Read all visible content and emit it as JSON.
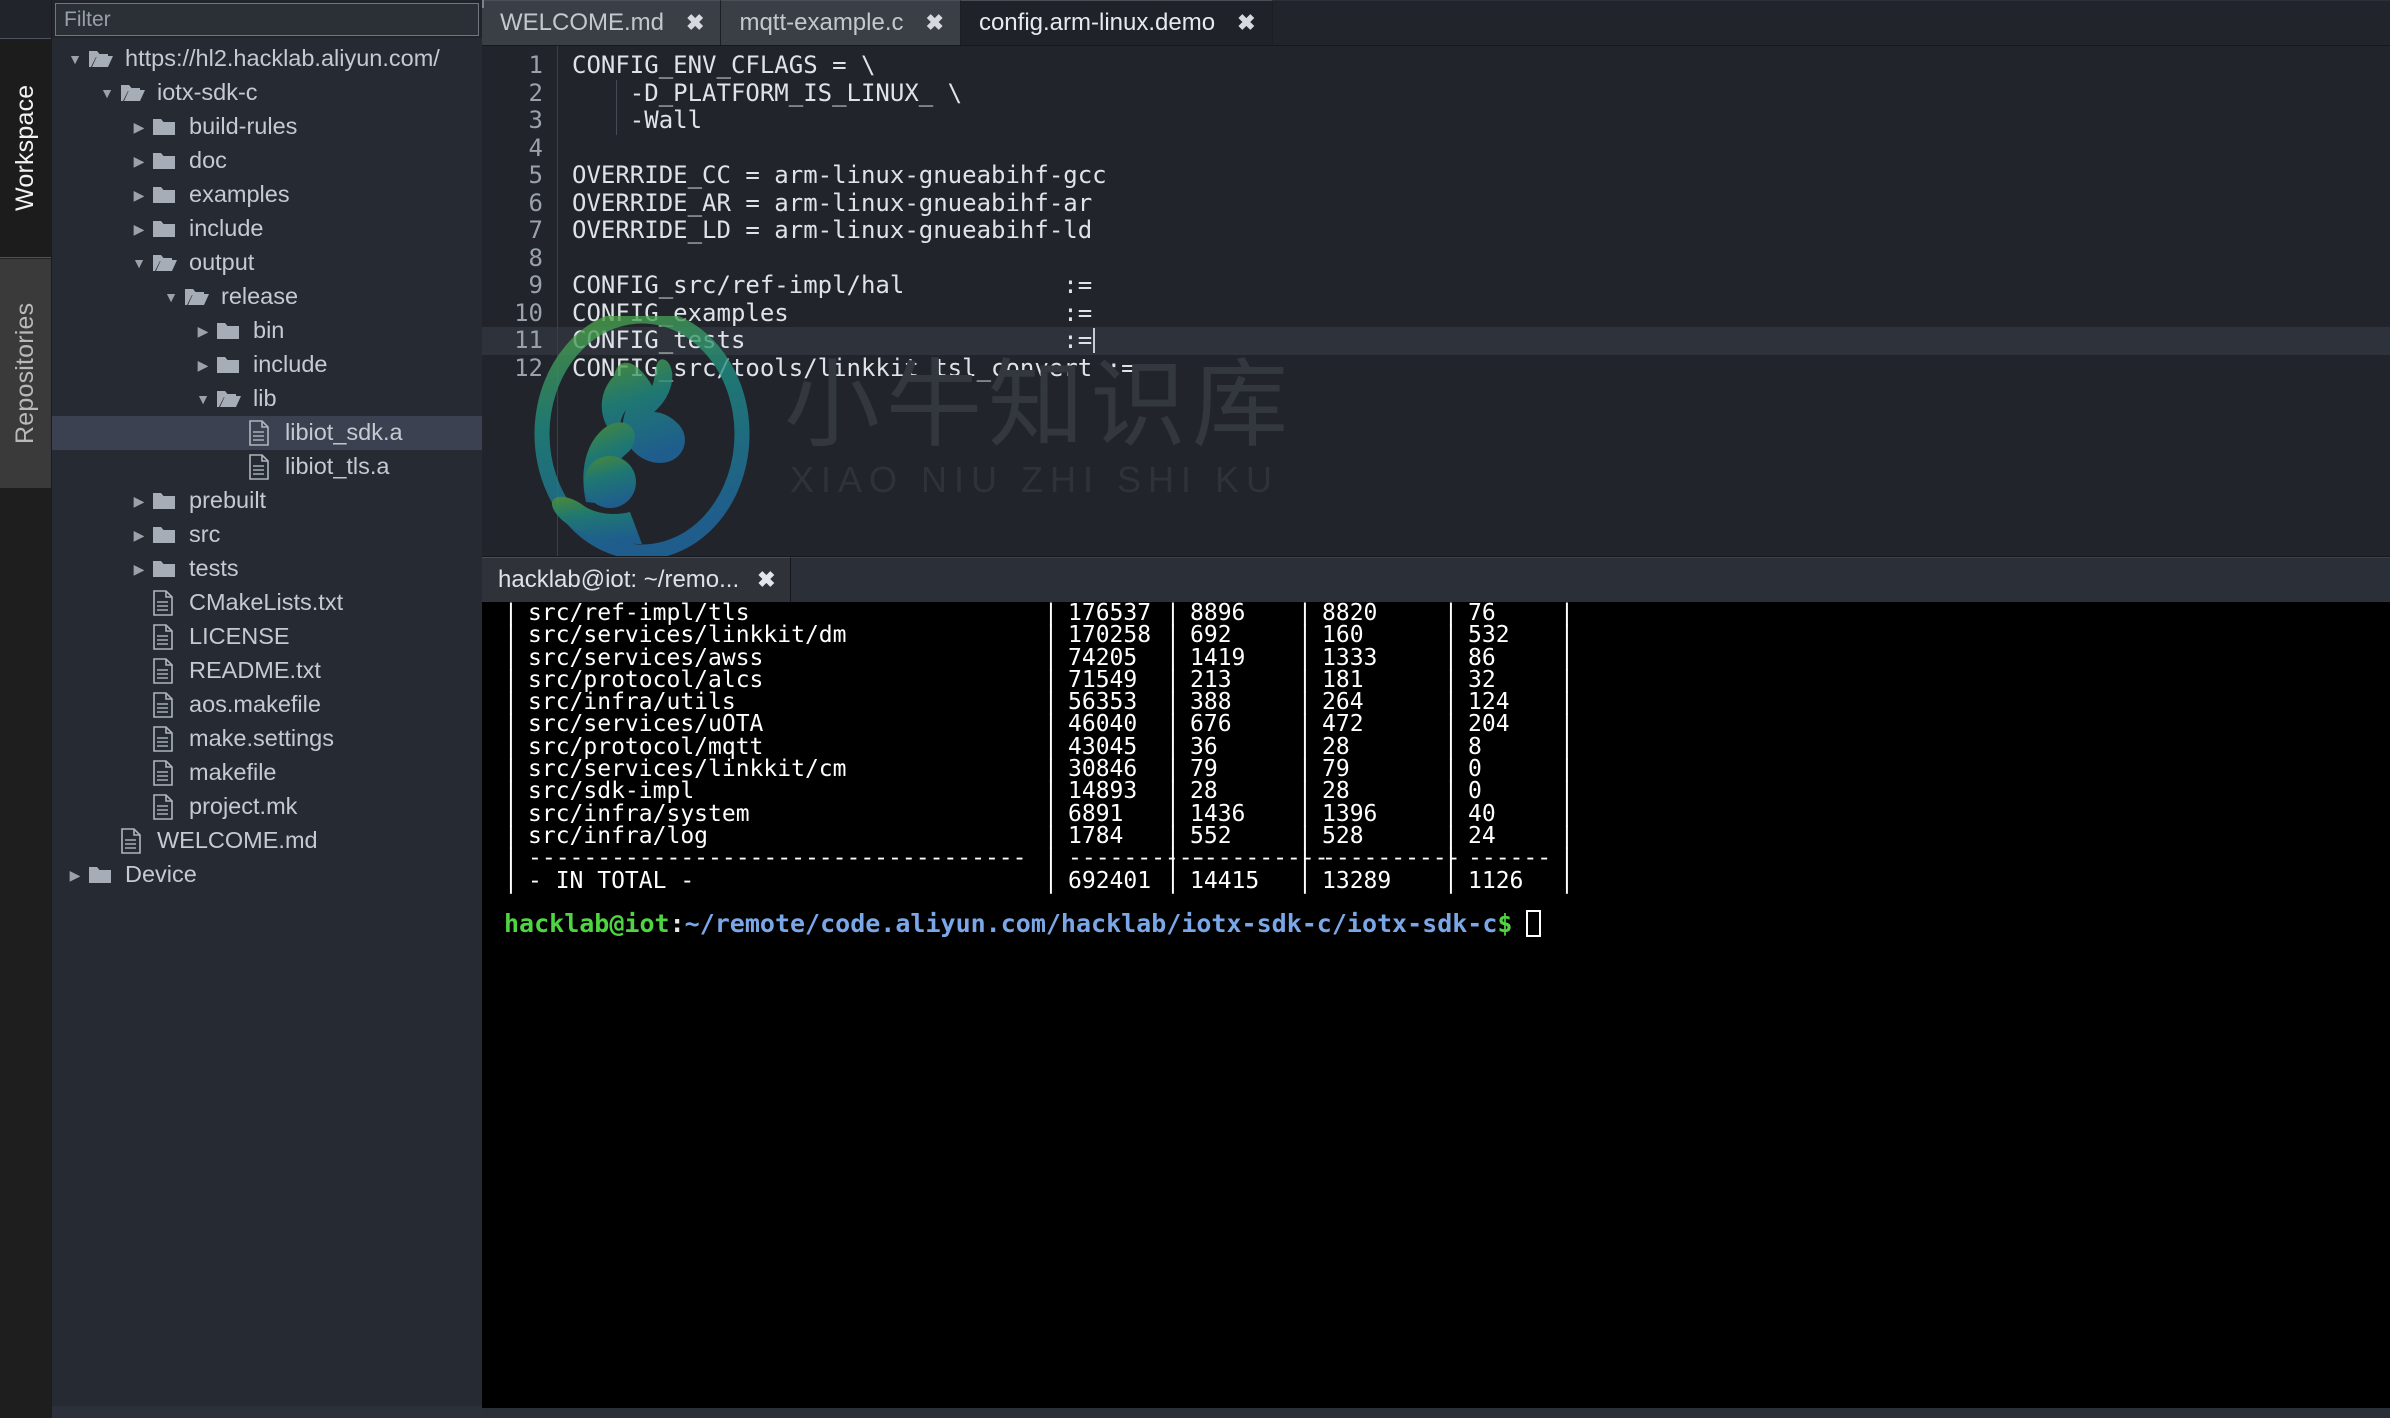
{
  "rail": {
    "tabs": [
      {
        "label": "Workspace",
        "active": true
      },
      {
        "label": "Repositories",
        "active": false
      }
    ]
  },
  "sidebar": {
    "filter": {
      "placeholder": "Filter",
      "value": ""
    },
    "tree": [
      {
        "label": "https://hl2.hacklab.aliyun.com/",
        "icon": "folder-open-icon",
        "twisty": "▼",
        "depth": 0,
        "selected": false
      },
      {
        "label": "iotx-sdk-c",
        "icon": "folder-open-icon",
        "twisty": "▼",
        "depth": 1,
        "selected": false
      },
      {
        "label": "build-rules",
        "icon": "folder-closed-icon",
        "twisty": "▶",
        "depth": 2,
        "selected": false
      },
      {
        "label": "doc",
        "icon": "folder-closed-icon",
        "twisty": "▶",
        "depth": 2,
        "selected": false
      },
      {
        "label": "examples",
        "icon": "folder-closed-icon",
        "twisty": "▶",
        "depth": 2,
        "selected": false
      },
      {
        "label": "include",
        "icon": "folder-closed-icon",
        "twisty": "▶",
        "depth": 2,
        "selected": false
      },
      {
        "label": "output",
        "icon": "folder-open-icon",
        "twisty": "▼",
        "depth": 2,
        "selected": false
      },
      {
        "label": "release",
        "icon": "folder-open-icon",
        "twisty": "▼",
        "depth": 3,
        "selected": false
      },
      {
        "label": "bin",
        "icon": "folder-closed-icon",
        "twisty": "▶",
        "depth": 4,
        "selected": false
      },
      {
        "label": "include",
        "icon": "folder-closed-icon",
        "twisty": "▶",
        "depth": 4,
        "selected": false
      },
      {
        "label": "lib",
        "icon": "folder-open-icon",
        "twisty": "▼",
        "depth": 4,
        "selected": false
      },
      {
        "label": "libiot_sdk.a",
        "icon": "file-icon",
        "twisty": "",
        "depth": 5,
        "selected": true
      },
      {
        "label": "libiot_tls.a",
        "icon": "file-icon",
        "twisty": "",
        "depth": 5,
        "selected": false
      },
      {
        "label": "prebuilt",
        "icon": "folder-closed-icon",
        "twisty": "▶",
        "depth": 2,
        "selected": false
      },
      {
        "label": "src",
        "icon": "folder-closed-icon",
        "twisty": "▶",
        "depth": 2,
        "selected": false
      },
      {
        "label": "tests",
        "icon": "folder-closed-icon",
        "twisty": "▶",
        "depth": 2,
        "selected": false
      },
      {
        "label": "CMakeLists.txt",
        "icon": "file-icon",
        "twisty": "",
        "depth": 2,
        "selected": false
      },
      {
        "label": "LICENSE",
        "icon": "file-icon",
        "twisty": "",
        "depth": 2,
        "selected": false
      },
      {
        "label": "README.txt",
        "icon": "file-icon",
        "twisty": "",
        "depth": 2,
        "selected": false
      },
      {
        "label": "aos.makefile",
        "icon": "file-icon",
        "twisty": "",
        "depth": 2,
        "selected": false
      },
      {
        "label": "make.settings",
        "icon": "file-icon",
        "twisty": "",
        "depth": 2,
        "selected": false
      },
      {
        "label": "makefile",
        "icon": "file-icon",
        "twisty": "",
        "depth": 2,
        "selected": false
      },
      {
        "label": "project.mk",
        "icon": "file-icon",
        "twisty": "",
        "depth": 2,
        "selected": false
      },
      {
        "label": "WELCOME.md",
        "icon": "file-icon",
        "twisty": "",
        "depth": 1,
        "selected": false
      },
      {
        "label": "Device",
        "icon": "folder-closed-icon",
        "twisty": "▶",
        "depth": 0,
        "selected": false
      }
    ]
  },
  "editor": {
    "tabs": [
      {
        "label": "WELCOME.md",
        "active": false,
        "close": "✖"
      },
      {
        "label": "mqtt-example.c",
        "active": false,
        "close": "✖"
      },
      {
        "label": "config.arm-linux.demo",
        "active": true,
        "close": "✖"
      }
    ],
    "current_line": 11,
    "lines": [
      {
        "n": "1",
        "text": "CONFIG_ENV_CFLAGS = \\"
      },
      {
        "n": "2",
        "text": "    -D_PLATFORM_IS_LINUX_ \\"
      },
      {
        "n": "3",
        "text": "    -Wall"
      },
      {
        "n": "4",
        "text": ""
      },
      {
        "n": "5",
        "text": "OVERRIDE_CC = arm-linux-gnueabihf-gcc"
      },
      {
        "n": "6",
        "text": "OVERRIDE_AR = arm-linux-gnueabihf-ar"
      },
      {
        "n": "7",
        "text": "OVERRIDE_LD = arm-linux-gnueabihf-ld"
      },
      {
        "n": "8",
        "text": ""
      },
      {
        "n": "9",
        "text": "CONFIG_src/ref-impl/hal           :="
      },
      {
        "n": "10",
        "text": "CONFIG_examples                   :="
      },
      {
        "n": "11",
        "text": "CONFIG_tests                      :="
      },
      {
        "n": "12",
        "text": "CONFIG_src/tools/linkkit_tsl_convert :="
      }
    ]
  },
  "watermark": {
    "cn_text": "小牛知识库",
    "pinyin_text": "XIAO NIU ZHI SHI KU",
    "color_top": "#4f9a3a",
    "color_bottom": "#1f6fa8"
  },
  "terminal": {
    "tab": {
      "label": "hacklab@iot: ~/remo...",
      "close": "✖"
    },
    "table": {
      "rows": [
        {
          "path": "src/ref-impl/tls",
          "c1": "176537",
          "c2": "8896",
          "c3": "8820",
          "c4": "76"
        },
        {
          "path": "src/services/linkkit/dm",
          "c1": "170258",
          "c2": "692",
          "c3": "160",
          "c4": "532"
        },
        {
          "path": "src/services/awss",
          "c1": "74205",
          "c2": "1419",
          "c3": "1333",
          "c4": "86"
        },
        {
          "path": "src/protocol/alcs",
          "c1": "71549",
          "c2": "213",
          "c3": "181",
          "c4": "32"
        },
        {
          "path": "src/infra/utils",
          "c1": "56353",
          "c2": "388",
          "c3": "264",
          "c4": "124"
        },
        {
          "path": "src/services/uOTA",
          "c1": "46040",
          "c2": "676",
          "c3": "472",
          "c4": "204"
        },
        {
          "path": "src/protocol/mqtt",
          "c1": "43045",
          "c2": "36",
          "c3": "28",
          "c4": "8"
        },
        {
          "path": "src/services/linkkit/cm",
          "c1": "30846",
          "c2": "79",
          "c3": "79",
          "c4": "0"
        },
        {
          "path": "src/sdk-impl",
          "c1": "14893",
          "c2": "28",
          "c3": "28",
          "c4": "0"
        },
        {
          "path": "src/infra/system",
          "c1": "6891",
          "c2": "1436",
          "c3": "1396",
          "c4": "40"
        },
        {
          "path": "src/infra/log",
          "c1": "1784",
          "c2": "552",
          "c3": "528",
          "c4": "24"
        }
      ],
      "separator": {
        "path": "------------------------------------",
        "c1": "----------",
        "c2": "----------",
        "c3": "----------",
        "c4": "------"
      },
      "total": {
        "path": "- IN TOTAL -",
        "c1": "692401",
        "c2": "14415",
        "c3": "13289",
        "c4": "1126"
      }
    },
    "prompt": {
      "user": "hacklab@iot",
      "colon": ":",
      "path": "~/remote/code.aliyun.com/hacklab/iotx-sdk-c/iotx-sdk-c",
      "dollar": "$"
    }
  }
}
